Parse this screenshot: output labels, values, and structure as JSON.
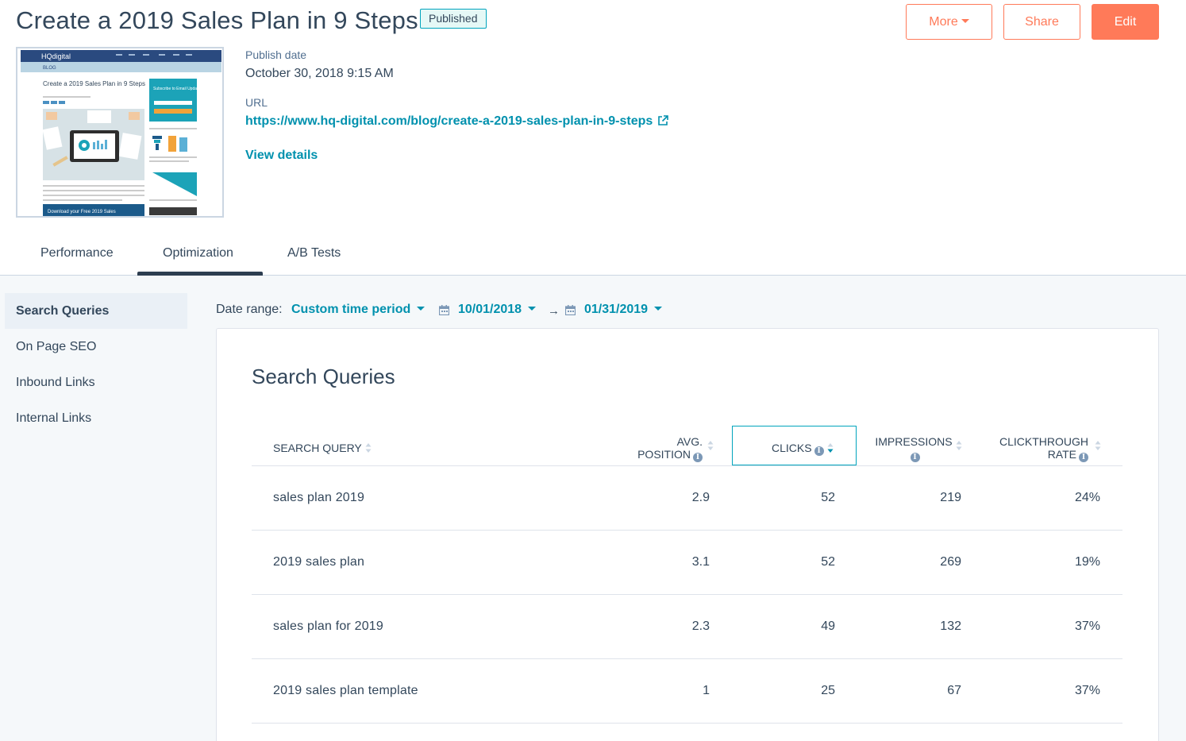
{
  "header": {
    "title": "Create a 2019 Sales Plan in 9 Steps",
    "status_badge": "Published",
    "buttons": {
      "more": "More",
      "share": "Share",
      "edit": "Edit"
    }
  },
  "details": {
    "publish_date_label": "Publish date",
    "publish_date": "October 30, 2018 9:15 AM",
    "url_label": "URL",
    "url": "https://www.hq-digital.com/blog/create-a-2019-sales-plan-in-9-steps",
    "view_details": "View details"
  },
  "thumbnail": {
    "logo": "HQdigital",
    "blog_label": "BLOG",
    "post_title": "Create a 2019 Sales Plan in 9 Steps",
    "subscribe_text": "Subscribe to Email Updates",
    "cta_text": "Download your Free 2019 Sales"
  },
  "tabs": [
    {
      "label": "Performance",
      "active": false
    },
    {
      "label": "Optimization",
      "active": true
    },
    {
      "label": "A/B Tests",
      "active": false
    }
  ],
  "sidebar": {
    "items": [
      {
        "label": "Search Queries",
        "active": true
      },
      {
        "label": "On Page SEO",
        "active": false
      },
      {
        "label": "Inbound Links",
        "active": false
      },
      {
        "label": "Internal Links",
        "active": false
      }
    ]
  },
  "filters": {
    "date_range_label": "Date range:",
    "period": "Custom time period",
    "start_date": "10/01/2018",
    "end_date": "01/31/2019"
  },
  "table": {
    "title": "Search Queries",
    "columns": {
      "query": "SEARCH QUERY",
      "position_1": "AVG.",
      "position_2": "POSITION",
      "clicks": "CLICKS",
      "impressions": "IMPRESSIONS",
      "ctr_1": "CLICKTHROUGH",
      "ctr_2": "RATE"
    },
    "sorted_by": "clicks",
    "rows": [
      {
        "query": "sales plan 2019",
        "position": "2.9",
        "clicks": "52",
        "impressions": "219",
        "ctr": "24%"
      },
      {
        "query": "2019 sales plan",
        "position": "3.1",
        "clicks": "52",
        "impressions": "269",
        "ctr": "19%"
      },
      {
        "query": "sales plan for 2019",
        "position": "2.3",
        "clicks": "49",
        "impressions": "132",
        "ctr": "37%"
      },
      {
        "query": "2019 sales plan template",
        "position": "1",
        "clicks": "25",
        "impressions": "67",
        "ctr": "37%"
      }
    ]
  },
  "colors": {
    "accent": "#ff7a59",
    "link": "#0091ae",
    "text": "#33475b",
    "badge_border": "#00a4bd",
    "tab_indicator": "#2d3e50"
  },
  "icons": [
    "external-link-icon",
    "calendar-icon",
    "arrow-right-icon",
    "sort-icon",
    "info-icon",
    "caret-down-icon"
  ]
}
